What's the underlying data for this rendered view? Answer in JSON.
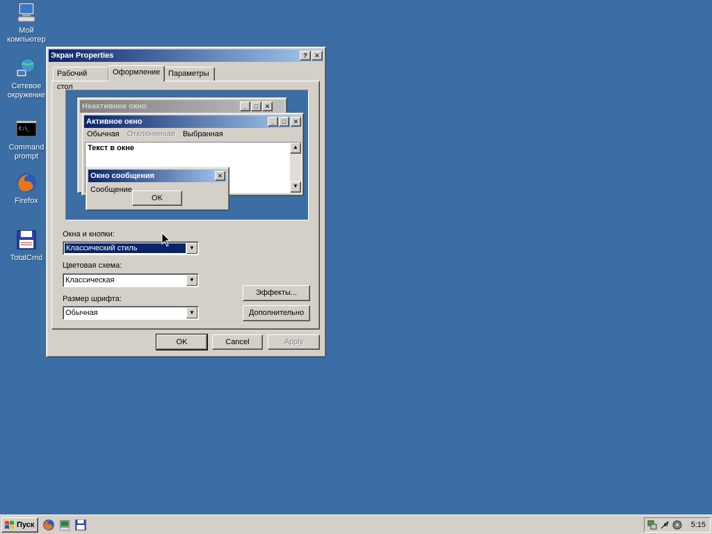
{
  "desktop": {
    "icons": [
      {
        "label": "Мой компьютер"
      },
      {
        "label": "Сетевое окружение"
      },
      {
        "label": "Command prompt"
      },
      {
        "label": "Firefox"
      },
      {
        "label": "TotalCmd"
      }
    ]
  },
  "window": {
    "title": "Экран Properties",
    "help_label": "?",
    "close_label": "✕",
    "tabs": [
      {
        "label": "Рабочий стол"
      },
      {
        "label": "Оформление"
      },
      {
        "label": "Параметры"
      }
    ],
    "active_tab": "Оформление",
    "preview": {
      "inactive_title": "Неактивное окно",
      "active_title": "Активное окно",
      "menu": [
        "Обычная",
        "Отключенная",
        "Выбранная"
      ],
      "window_text": "Текст в окне",
      "message_title": "Окно сообщения",
      "message_text": "Сообщение",
      "ok_label": "OK"
    },
    "fields": {
      "windows_buttons_label": "Окна и кнопки:",
      "windows_buttons_value": "Классический стиль",
      "color_scheme_label": "Цветовая схема:",
      "color_scheme_value": "Классическая",
      "font_size_label": "Размер шрифта:",
      "font_size_value": "Обычная"
    },
    "effects_label": "Эффекты...",
    "advanced_label": "Дополнительно",
    "ok_label": "OK",
    "cancel_label": "Cancel",
    "apply_label": "Apply"
  },
  "taskbar": {
    "start_label": "Пуск",
    "clock": "5:15"
  },
  "colors": {
    "desktop": "#3a6ea5",
    "face": "#d4d0c8",
    "title_active": "#0a246a",
    "title_active_end": "#a6caf0"
  }
}
